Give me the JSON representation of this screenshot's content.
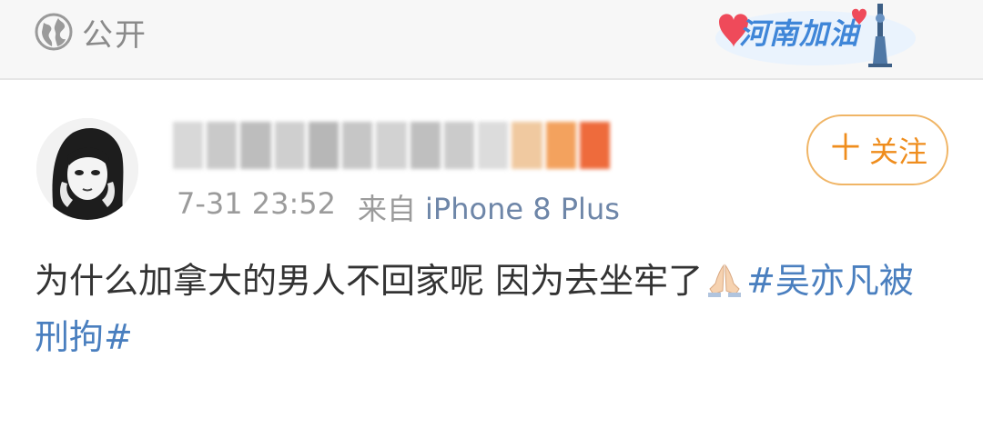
{
  "topbar": {
    "visibility_icon": "globe-icon",
    "visibility_label": "公开",
    "badge_text": "河南加油"
  },
  "author": {
    "avatar_icon": "avatar",
    "username_obscured": true,
    "timestamp": "7-31 23:52",
    "source_prefix": "来自",
    "device": "iPhone 8 Plus",
    "follow_label": "关注",
    "follow_icon": "plus-icon"
  },
  "post": {
    "text": "为什么加拿大的男人不回家呢 因为去坐牢了",
    "emoji": "pray-emoji",
    "hashtag": "#吴亦凡被刑拘#"
  },
  "colors": {
    "topbar_bg": "#f7f7f7",
    "follow_accent": "#ef8d1d",
    "link_blue": "#4a7fbf",
    "badge_blue": "#3f86d8"
  }
}
